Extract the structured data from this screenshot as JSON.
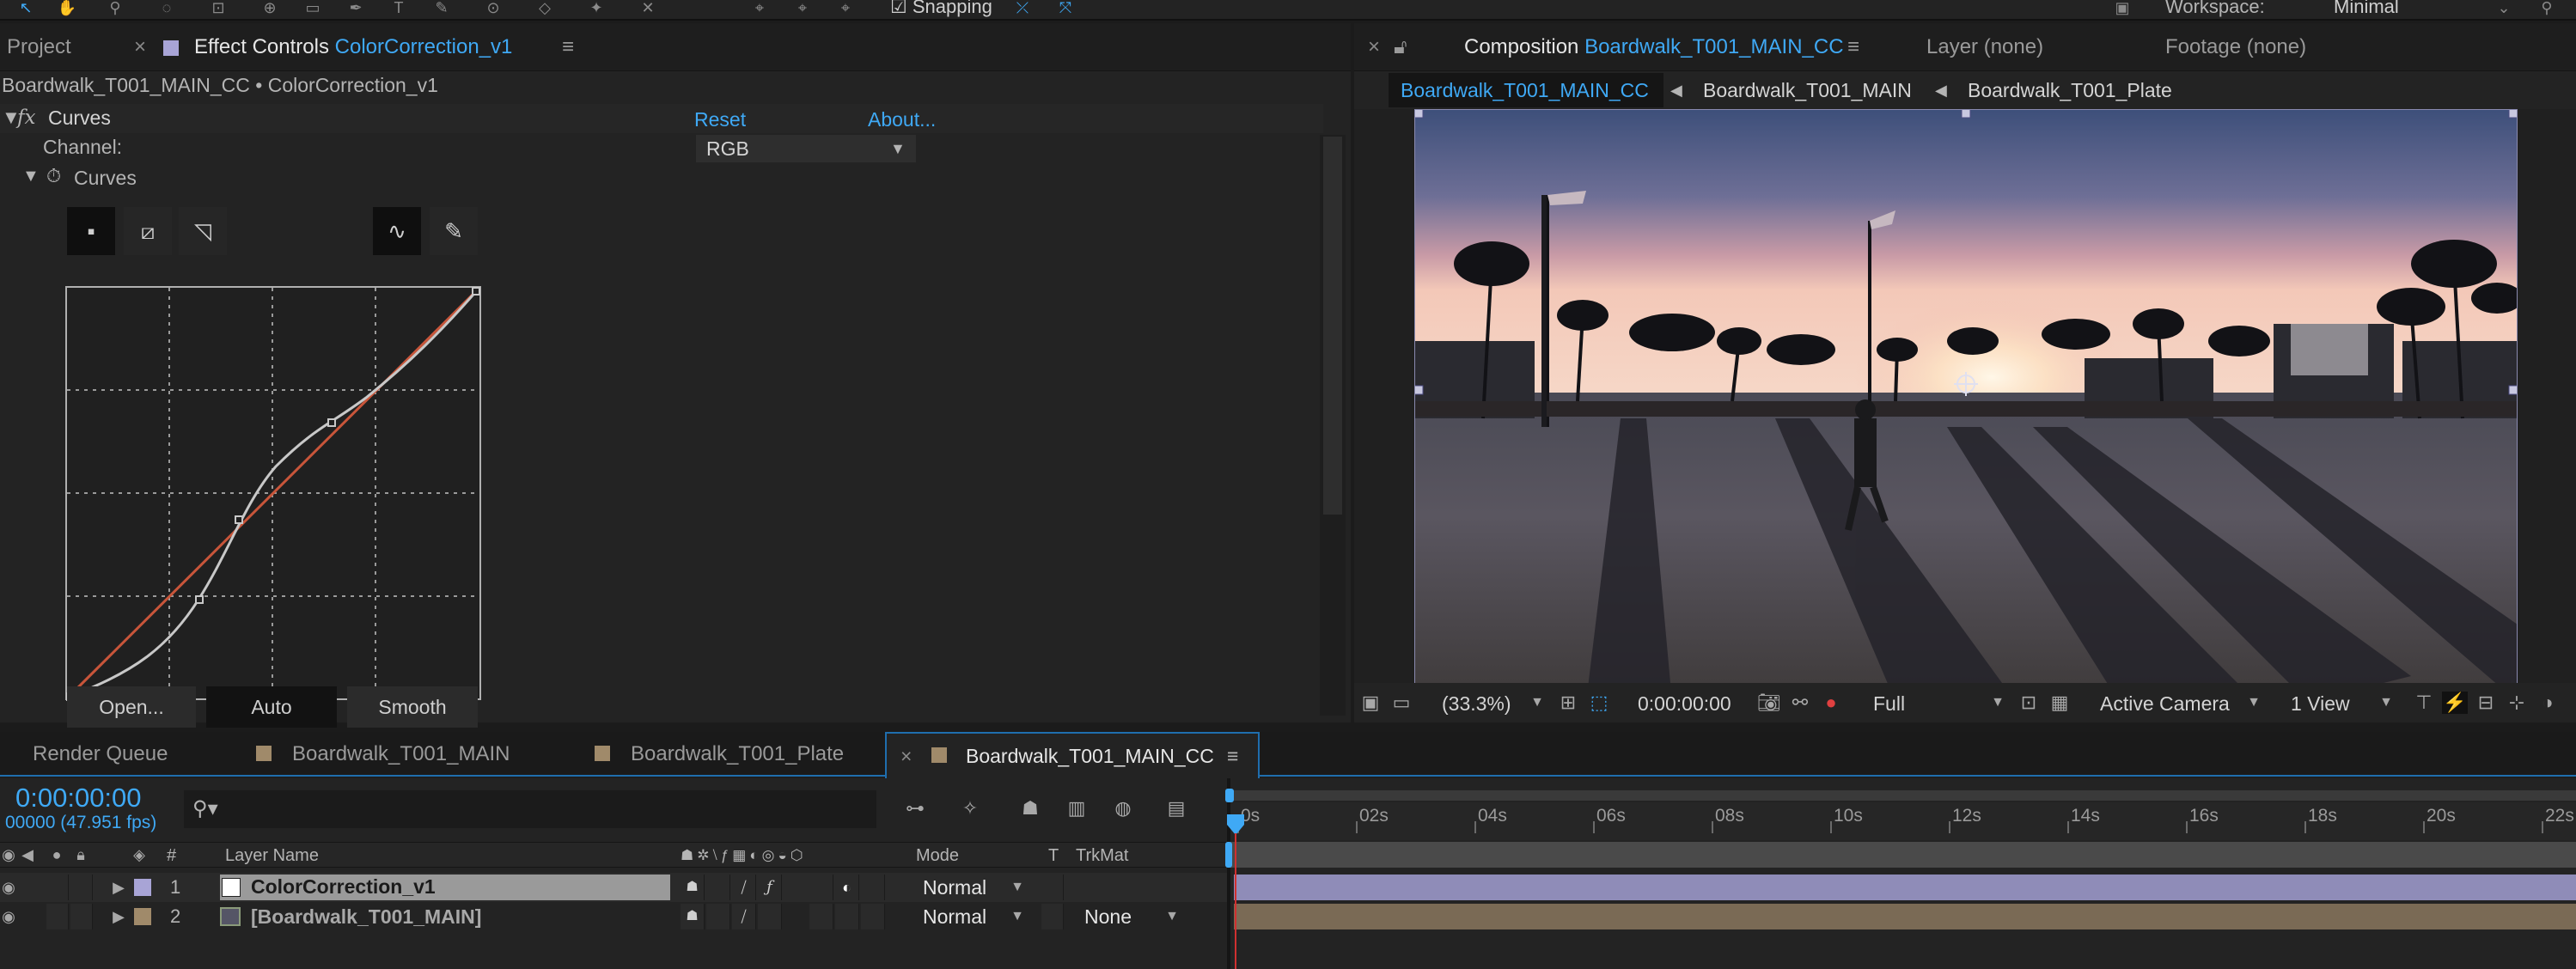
{
  "toolbar": {
    "snapping_label": "Snapping",
    "workspace_label": "Workspace:",
    "workspace_value": "Minimal"
  },
  "project_tab": "Project",
  "effect_controls": {
    "tab_prefix": "Effect Controls",
    "tab_layer": "ColorCorrection_v1",
    "breadcrumb": "Boardwalk_T001_MAIN_CC • ColorCorrection_v1",
    "effect_name": "Curves",
    "fx_glyph": "fx",
    "reset": "Reset",
    "about": "About...",
    "channel_label": "Channel:",
    "channel_value": "RGB",
    "prop_name": "Curves",
    "buttons": {
      "open": "Open...",
      "auto": "Auto",
      "smooth": "Smooth"
    }
  },
  "composition": {
    "tab_prefix": "Composition",
    "tab_name": "Boardwalk_T001_MAIN_CC",
    "layer_tab": "Layer (none)",
    "footage_tab": "Footage (none)",
    "breadcrumbs": [
      "Boardwalk_T001_MAIN_CC",
      "Boardwalk_T001_MAIN",
      "Boardwalk_T001_Plate"
    ],
    "footer": {
      "zoom": "(33.3%)",
      "timecode": "0:00:00:00",
      "resolution": "Full",
      "camera": "Active Camera",
      "views": "1 View"
    }
  },
  "timeline_tabs": [
    {
      "label": "Render Queue",
      "color": ""
    },
    {
      "label": "Boardwalk_T001_MAIN",
      "color": "#a08a6a"
    },
    {
      "label": "Boardwalk_T001_Plate",
      "color": "#a08a6a"
    },
    {
      "label": "Boardwalk_T001_MAIN_CC",
      "color": "#a08a6a"
    }
  ],
  "timeline": {
    "current_time": "0:00:00:00",
    "frame_info": "00000 (47.951 fps)",
    "columns": {
      "hash": "#",
      "layer_name": "Layer Name",
      "mode": "Mode",
      "t": "T",
      "trkmat": "TrkMat"
    },
    "layers": [
      {
        "num": "1",
        "name": "ColorCorrection_v1",
        "mode": "Normal",
        "trkmat": "",
        "label_color": "#a8a4d6"
      },
      {
        "num": "2",
        "name": "[Boardwalk_T001_MAIN]",
        "mode": "Normal",
        "trkmat": "None",
        "label_color": "#a08a6a"
      }
    ],
    "ruler": [
      "0s",
      "02s",
      "04s",
      "06s",
      "08s",
      "10s",
      "12s",
      "14s",
      "16s",
      "18s",
      "20s",
      "22s"
    ]
  },
  "colors": {
    "accent": "#3fa9f5",
    "curve_diagonal": "#c8553a",
    "layer1_bar": "#8f8cb8",
    "layer2_bar": "#7a6a55"
  }
}
